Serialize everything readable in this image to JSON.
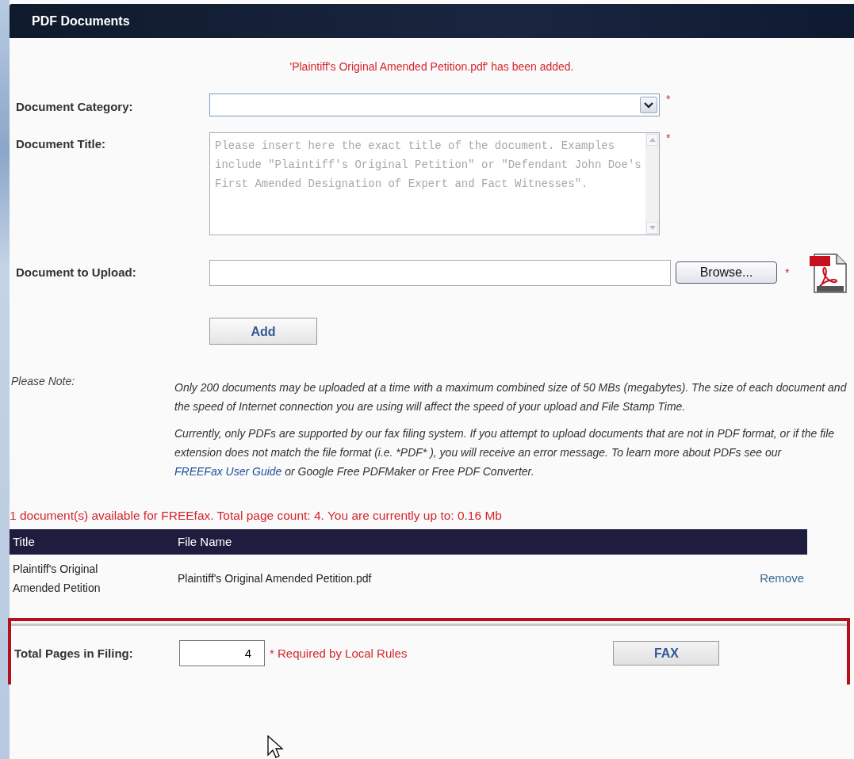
{
  "panel": {
    "title": "PDF Documents"
  },
  "message": "'Plaintiff's Original Amended Petition.pdf' has been added.",
  "fields": [
    {
      "kind": "select",
      "label": "Document Category:",
      "required_mark": "*"
    },
    {
      "kind": "textarea",
      "label": "Document Title:",
      "placeholder": "Please insert here the exact title of the document. Examples include \"Plaintiff's Original Petition\" or \"Defendant John Doe's First Amended Designation of Expert and Fact Witnesses\".",
      "required_mark": "*"
    },
    {
      "kind": "file",
      "label": "Document to Upload:",
      "button": "Browse...",
      "required_mark": "*"
    }
  ],
  "add_button": "Add",
  "note": {
    "label": "Please Note:",
    "paragraphs": [
      [
        {
          "kind": "text",
          "text": "Only 200 documents may be uploaded at a time with a maximum combined size of 50 MBs (megabytes). The size of each document and the speed of Internet connection you are using will affect the speed of your upload and File Stamp Time."
        }
      ],
      [
        {
          "kind": "text",
          "text": "Currently, only PDFs are supported by our fax filing system. If you attempt to upload documents that are not in PDF format, or if the file extension does not match the file format (i.e. *PDF* ), you will receive an error message. To learn more about PDFs see our "
        },
        {
          "kind": "link",
          "text": "FREEFax User Guide"
        },
        {
          "kind": "text",
          "text": " or Google Free PDFMaker or Free PDF Converter."
        }
      ]
    ]
  },
  "summary": "1 document(s) available for FREEfax. Total page count: 4. You are currently up to: 0.16 Mb",
  "table": {
    "columns": [
      "Title",
      "File Name"
    ],
    "rows": [
      {
        "title": "Plaintiff's Original Amended Petition",
        "file_name": "Plaintiff's Original Amended Petition.pdf",
        "action": "Remove"
      }
    ]
  },
  "filing": {
    "label": "Total Pages in Filing:",
    "value": "4",
    "required_note": "* Required by Local Rules",
    "button": "FAX"
  }
}
